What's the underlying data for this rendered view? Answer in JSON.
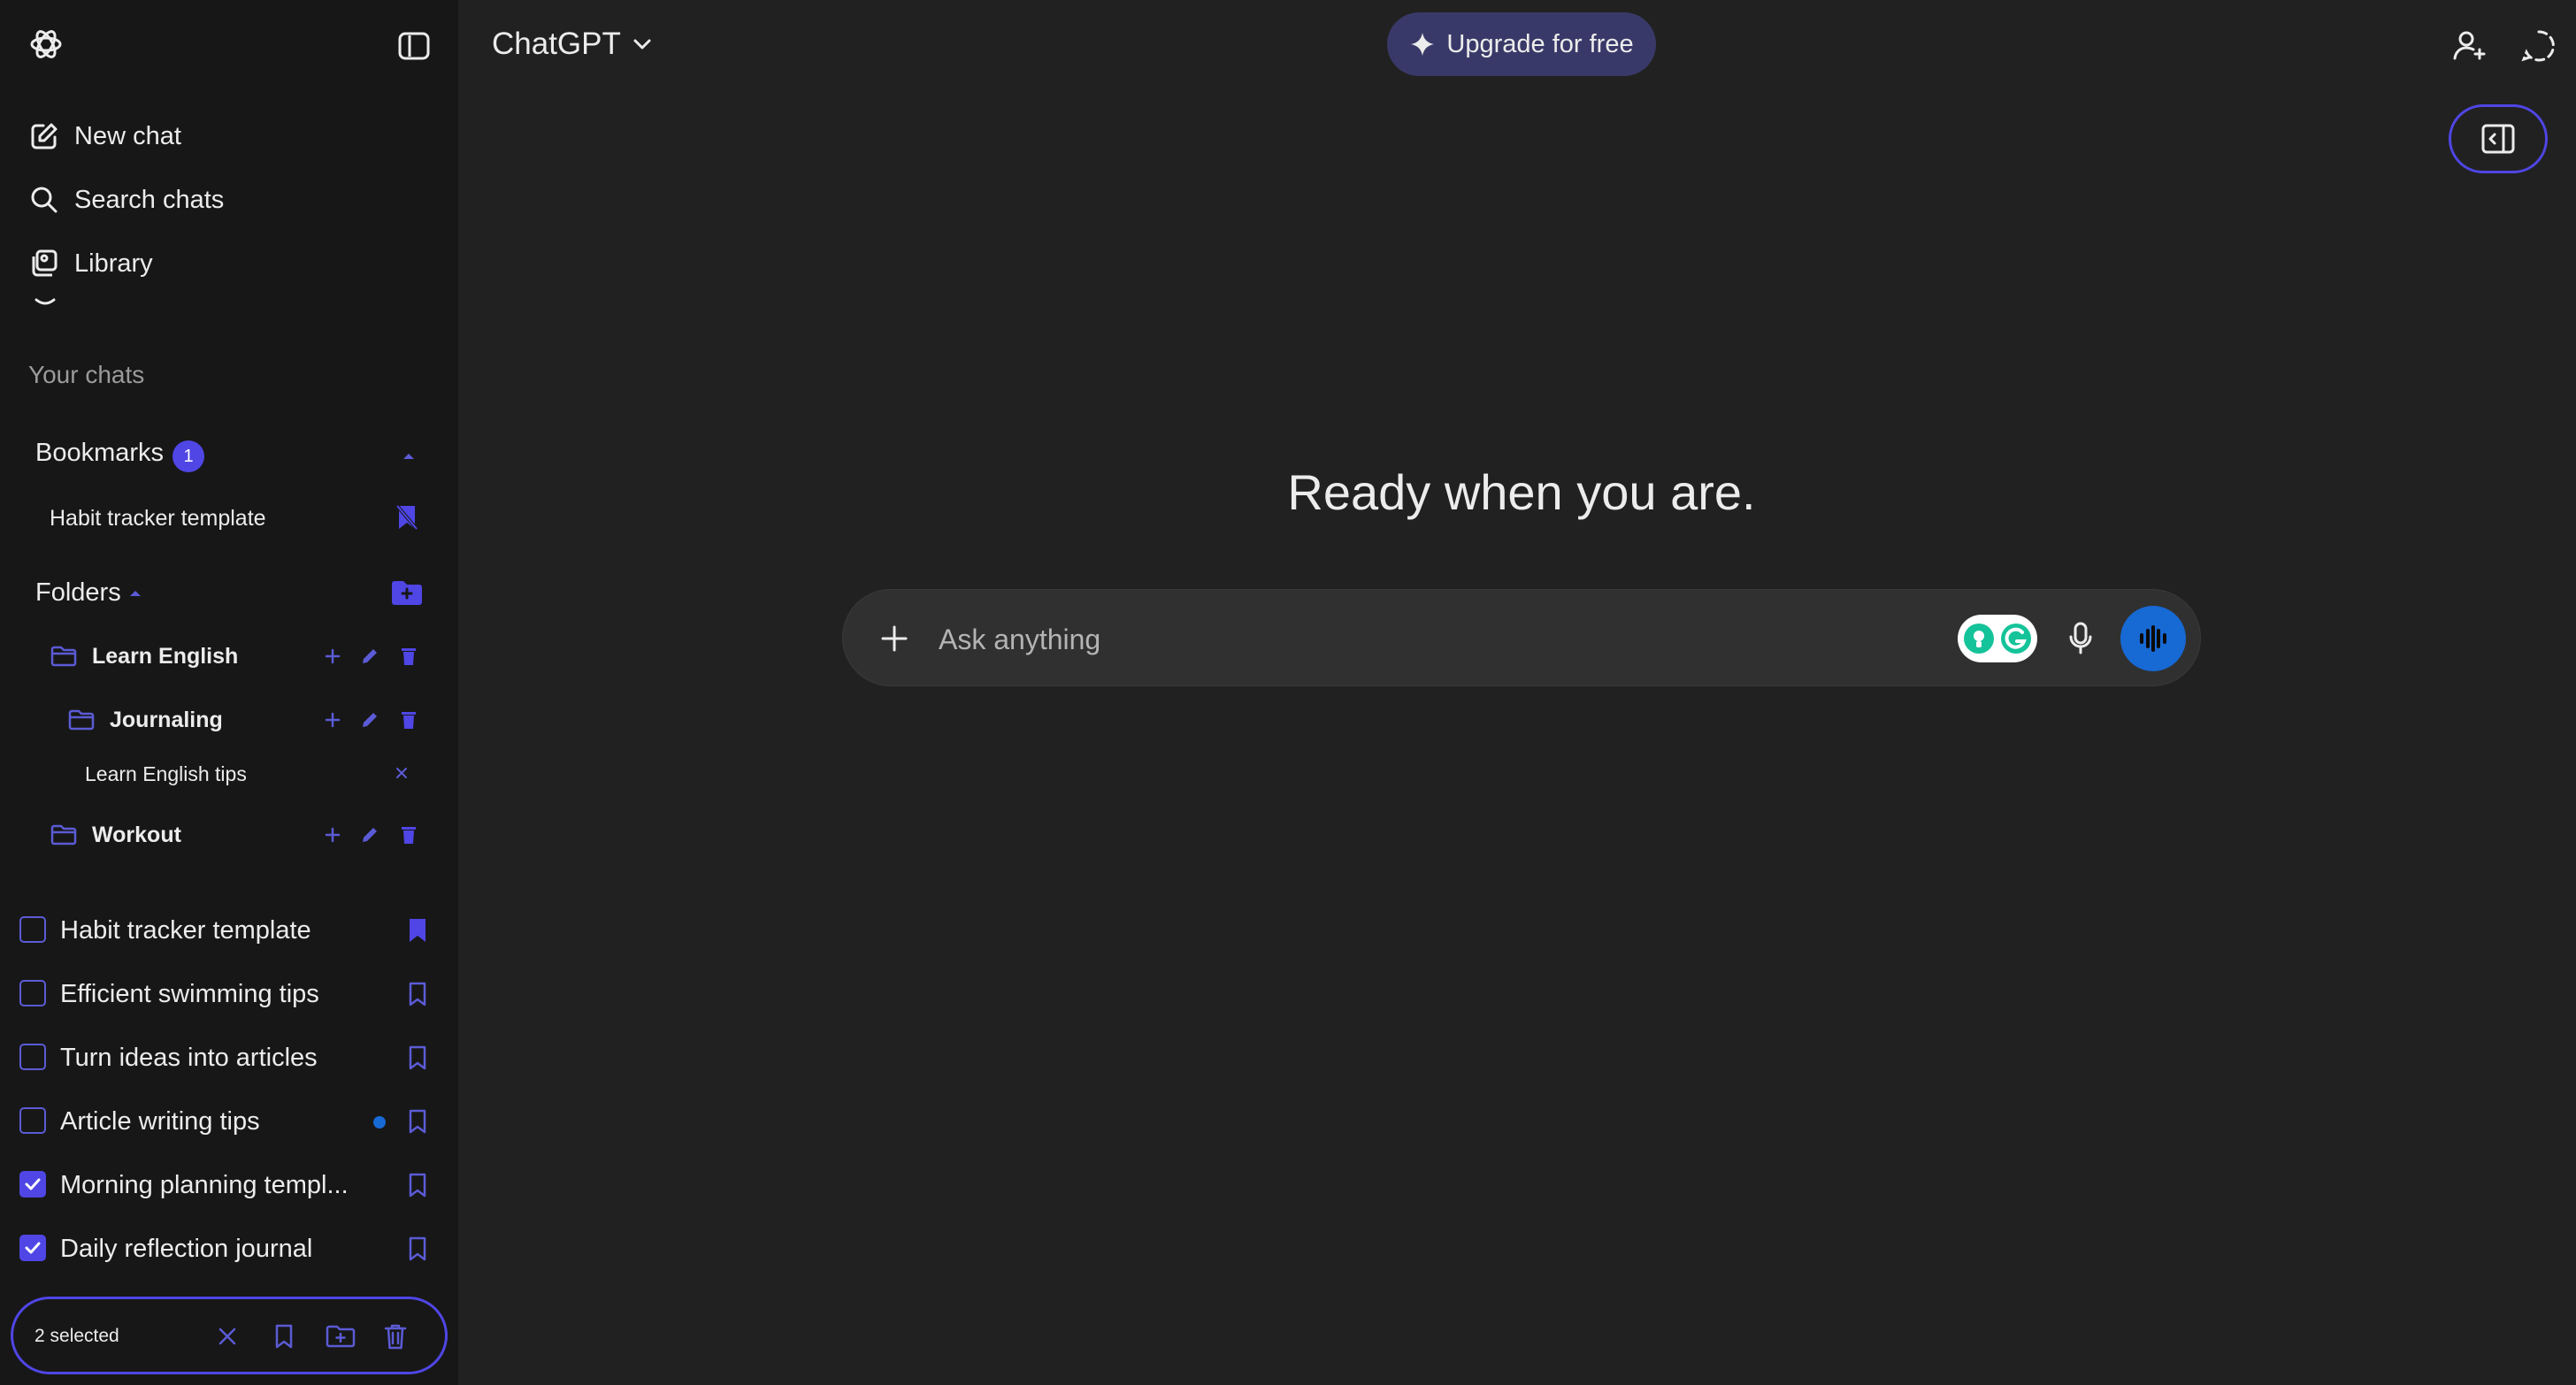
{
  "app": {
    "title": "ChatGPT"
  },
  "sidebar": {
    "nav": [
      {
        "label": "New chat",
        "icon": "edit-icon"
      },
      {
        "label": "Search chats",
        "icon": "search-icon"
      },
      {
        "label": "Library",
        "icon": "library-icon"
      }
    ],
    "section_label": "Your chats",
    "bookmarks": {
      "title": "Bookmarks",
      "count": "1",
      "items": [
        {
          "label": "Habit tracker template"
        }
      ]
    },
    "folders": {
      "title": "Folders",
      "items": [
        {
          "name": "Learn English"
        },
        {
          "name": "Journaling"
        },
        {
          "name": "Workout"
        }
      ],
      "nested_chat": "Learn English tips"
    },
    "chats": [
      {
        "title": "Habit tracker template",
        "checked": false,
        "bookmarked": true
      },
      {
        "title": "Efficient swimming tips",
        "checked": false,
        "bookmarked": false
      },
      {
        "title": "Turn ideas into articles",
        "checked": false,
        "bookmarked": false
      },
      {
        "title": "Article writing tips",
        "checked": false,
        "bookmarked": false,
        "unread": true
      },
      {
        "title": "Morning planning templ...",
        "checked": true,
        "bookmarked": false
      },
      {
        "title": "Daily reflection journal",
        "checked": true,
        "bookmarked": false
      }
    ],
    "selection_bar": {
      "label": "2 selected"
    }
  },
  "header": {
    "title": "ChatGPT",
    "upgrade_label": "Upgrade for free"
  },
  "main": {
    "hero": "Ready when you are.",
    "composer": {
      "placeholder": "Ask anything"
    }
  },
  "colors": {
    "accent": "#4f46e5",
    "sidebar_bg": "#171717",
    "main_bg": "#212121",
    "voice_button": "#1769d4",
    "upgrade_bg": "#393969"
  }
}
